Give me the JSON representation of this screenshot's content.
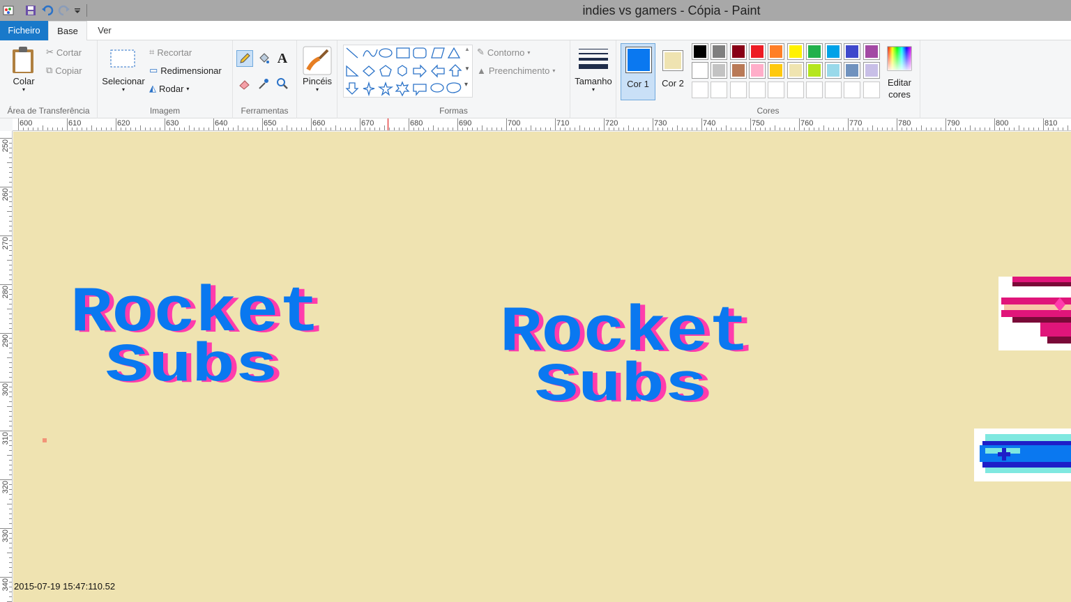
{
  "window": {
    "title": "indies vs gamers - Cópia - Paint"
  },
  "tabs": [
    {
      "label": "Ficheiro"
    },
    {
      "label": "Base"
    },
    {
      "label": "Ver"
    }
  ],
  "clipboard": {
    "paste_label": "Colar",
    "cut_label": "Cortar",
    "copy_label": "Copiar",
    "group_label": "Área de Transferência"
  },
  "image": {
    "select_label": "Selecionar",
    "crop_label": "Recortar",
    "resize_label": "Redimensionar",
    "rotate_label": "Rodar",
    "group_label": "Imagem"
  },
  "tools": {
    "group_label": "Ferramentas"
  },
  "brushes": {
    "label": "Pincéis"
  },
  "shapes": {
    "outline_label": "Contorno",
    "fill_label": "Preenchimento",
    "group_label": "Formas"
  },
  "size": {
    "label": "Tamanho"
  },
  "colors": {
    "color1_label": "Cor 1",
    "color2_label": "Cor 2",
    "color1": "#0a78f0",
    "color2": "#efe3b1",
    "edit_label": "Editar cores",
    "group_label": "Cores",
    "palette_row1": [
      "#000000",
      "#7f7f7f",
      "#880015",
      "#ed1c24",
      "#ff7f27",
      "#fff200",
      "#22b14c",
      "#00a2e8",
      "#3f48cc",
      "#a349a4"
    ],
    "palette_row2": [
      "#ffffff",
      "#c3c3c3",
      "#b97a57",
      "#ffaec9",
      "#ffc90e",
      "#efe4b0",
      "#b5e61d",
      "#99d9ea",
      "#7092be",
      "#c8bfe7"
    ]
  },
  "rulers": {
    "h_ticks": [
      "600",
      "610",
      "620",
      "630",
      "640",
      "650",
      "660",
      "670",
      "680",
      "690",
      "700",
      "710",
      "720",
      "730",
      "740",
      "750",
      "760",
      "770",
      "780",
      "790",
      "800",
      "810"
    ],
    "v_ticks": [
      "250",
      "260",
      "270",
      "280",
      "290",
      "300",
      "310",
      "320",
      "330",
      "340"
    ]
  },
  "canvas": {
    "background": "#efe3b1",
    "logo1": {
      "line1": "Rocket",
      "line2": "Subs"
    },
    "logo2": {
      "line1": "Rocket",
      "line2": "Subs"
    },
    "timestamp": "2015-07-19 15:47:110.52"
  }
}
